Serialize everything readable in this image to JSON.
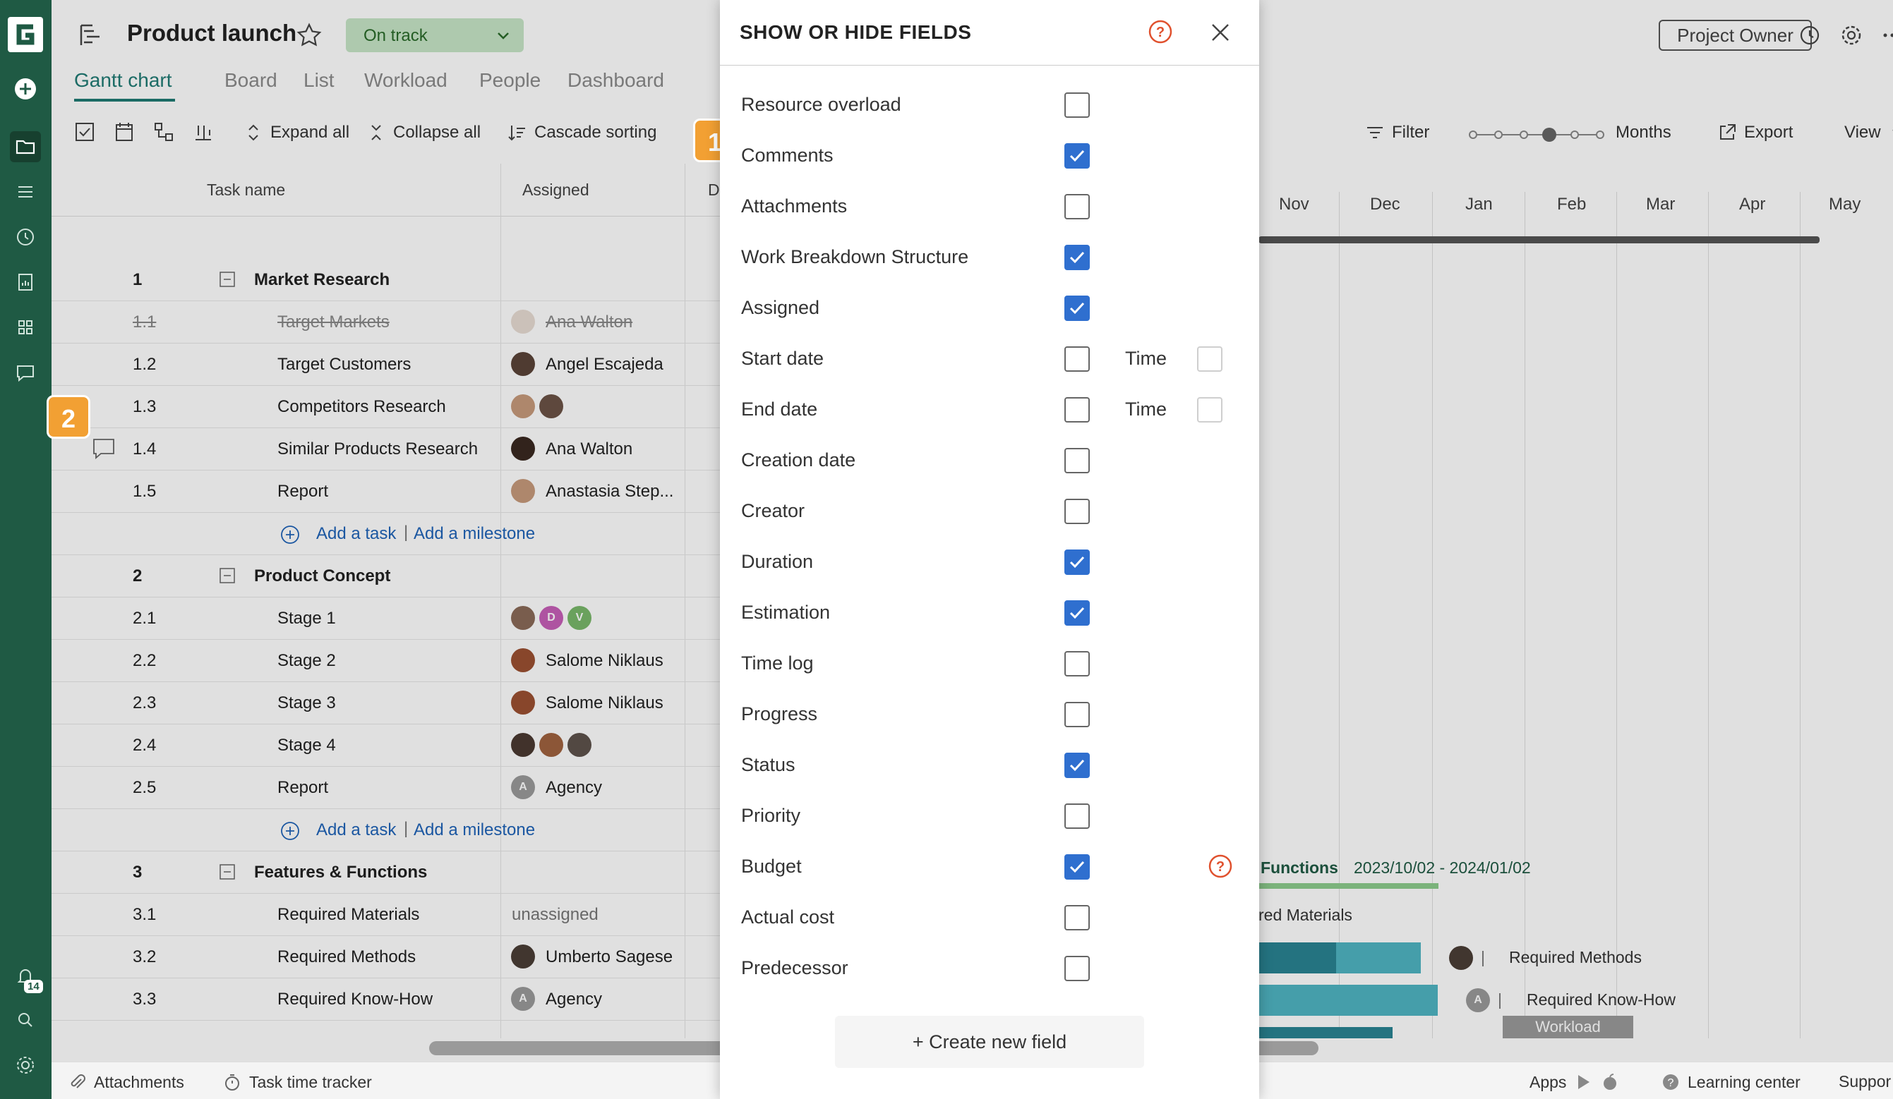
{
  "app": {
    "project_title": "Product launch",
    "status_label": "On track"
  },
  "tabs": [
    "Gantt chart",
    "Board",
    "List",
    "Workload",
    "People",
    "Dashboard"
  ],
  "toolbar": {
    "expand_all": "Expand all",
    "collapse_all": "Collapse all",
    "cascade_sorting": "Cascade sorting",
    "filter": "Filter",
    "zoom_label": "Months",
    "export": "Export",
    "view": "View"
  },
  "header_right": {
    "project_owner": "Project Owner"
  },
  "grid": {
    "columns": [
      "Task name",
      "Assigned",
      "D"
    ],
    "rows": [
      {
        "num": "1",
        "name": "Market Research",
        "assigned": "",
        "group": true
      },
      {
        "num": "1.1",
        "name": "Target Markets",
        "assigned": "Ana Walton",
        "done": true
      },
      {
        "num": "1.2",
        "name": "Target Customers",
        "assigned": "Angel Escajeda"
      },
      {
        "num": "1.3",
        "name": "Competitors Research",
        "assigned": ""
      },
      {
        "num": "1.4",
        "name": "Similar Products Research",
        "assigned": "Ana Walton"
      },
      {
        "num": "1.5",
        "name": "Report",
        "assigned": "Anastasia Step..."
      },
      {
        "num": "2",
        "name": "Product Concept",
        "assigned": "",
        "group": true
      },
      {
        "num": "2.1",
        "name": "Stage 1",
        "assigned": ""
      },
      {
        "num": "2.2",
        "name": "Stage 2",
        "assigned": "Salome Niklaus"
      },
      {
        "num": "2.3",
        "name": "Stage 3",
        "assigned": "Salome Niklaus"
      },
      {
        "num": "2.4",
        "name": "Stage 4",
        "assigned": ""
      },
      {
        "num": "2.5",
        "name": "Report",
        "assigned": "Agency"
      },
      {
        "num": "3",
        "name": "Features & Functions",
        "assigned": "",
        "group": true
      },
      {
        "num": "3.1",
        "name": "Required Materials",
        "assigned": "unassigned"
      },
      {
        "num": "3.2",
        "name": "Required Methods",
        "assigned": "Umberto Sagese"
      },
      {
        "num": "3.3",
        "name": "Required Know-How",
        "assigned": "Agency"
      }
    ],
    "add_task": "Add a task",
    "add_milestone": "Add a milestone",
    "avatar_initials": {
      "d": "D",
      "v": "V",
      "a": "A"
    }
  },
  "gantt": {
    "months": [
      "Nov",
      "Dec",
      "Jan",
      "Feb",
      "Mar",
      "Apr",
      "May"
    ],
    "group_label": "Functions",
    "group_dates": "2023/10/02 - 2024/01/02",
    "row_labels": [
      "red Materials",
      "Required Methods",
      "Required Know-How"
    ],
    "workload_label": "Workload"
  },
  "bottom_bar": {
    "attachments": "Attachments",
    "time_tracker": "Task time tracker",
    "apps": "Apps",
    "learning_center": "Learning center",
    "support": "Suppor"
  },
  "badges": {
    "one": "1",
    "two": "2"
  },
  "sidebar": {
    "notification_count": "14"
  },
  "modal": {
    "title": "SHOW OR HIDE FIELDS",
    "time_label": "Time",
    "create_button": "+ Create new field",
    "fields": [
      {
        "label": "Resource overload",
        "checked": false
      },
      {
        "label": "Comments",
        "checked": true
      },
      {
        "label": "Attachments",
        "checked": false
      },
      {
        "label": "Work Breakdown Structure",
        "checked": true
      },
      {
        "label": "Assigned",
        "checked": true
      },
      {
        "label": "Start date",
        "checked": false,
        "time": true
      },
      {
        "label": "End date",
        "checked": false,
        "time": true
      },
      {
        "label": "Creation date",
        "checked": false
      },
      {
        "label": "Creator",
        "checked": false
      },
      {
        "label": "Duration",
        "checked": true
      },
      {
        "label": "Estimation",
        "checked": true
      },
      {
        "label": "Time log",
        "checked": false
      },
      {
        "label": "Progress",
        "checked": false
      },
      {
        "label": "Status",
        "checked": true
      },
      {
        "label": "Priority",
        "checked": false
      },
      {
        "label": "Budget",
        "checked": true,
        "help": true
      },
      {
        "label": "Actual cost",
        "checked": false
      },
      {
        "label": "Predecessor",
        "checked": false
      }
    ]
  },
  "colors": {
    "sidebar": "#1f5a44",
    "accent": "#1f7a74",
    "checkbox_on": "#2f6fcf",
    "badge": "#f2a033",
    "status_pill": "#c6e5c6"
  }
}
